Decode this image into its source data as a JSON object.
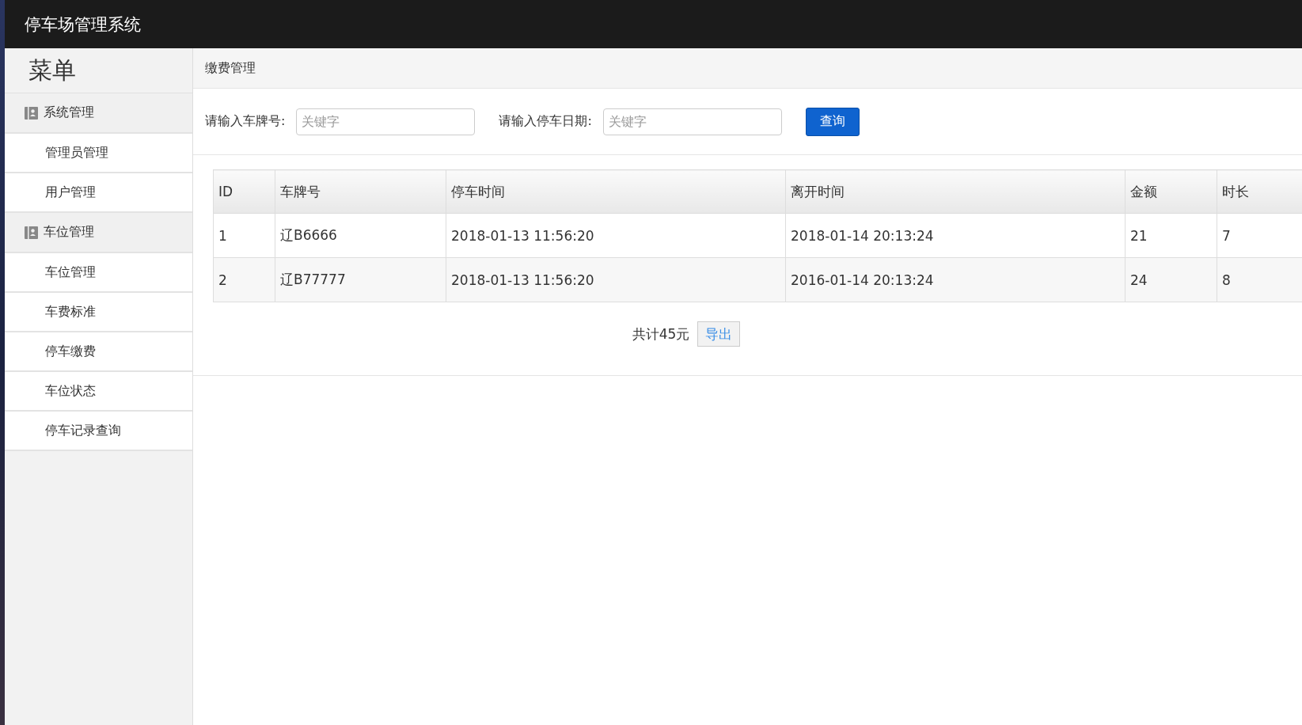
{
  "app_title": "停车场管理系统",
  "sidebar": {
    "title": "菜单",
    "groups": [
      {
        "label": "系统管理",
        "children": [
          {
            "label": "管理员管理"
          },
          {
            "label": "用户管理"
          }
        ]
      },
      {
        "label": "车位管理",
        "children": [
          {
            "label": "车位管理"
          },
          {
            "label": "车费标准"
          },
          {
            "label": "停车缴费"
          },
          {
            "label": "车位状态"
          },
          {
            "label": "停车记录查询"
          }
        ]
      }
    ]
  },
  "breadcrumb": "缴费管理",
  "search": {
    "fields": [
      {
        "label": "请输入车牌号:",
        "placeholder": "关键字"
      },
      {
        "label": "请输入停车日期:",
        "placeholder": "关键字"
      }
    ],
    "button": "查询"
  },
  "table": {
    "columns": [
      "ID",
      "车牌号",
      "停车时间",
      "离开时间",
      "金额",
      "时长"
    ],
    "rows": [
      [
        "1",
        "辽B6666",
        "2018-01-13 11:56:20",
        "2018-01-14 20:13:24",
        "21",
        "7"
      ],
      [
        "2",
        "辽B77777",
        "2018-01-13 11:56:20",
        "2016-01-14 20:13:24",
        "24",
        "8"
      ]
    ]
  },
  "total": "共计45元",
  "export_button": "导出"
}
